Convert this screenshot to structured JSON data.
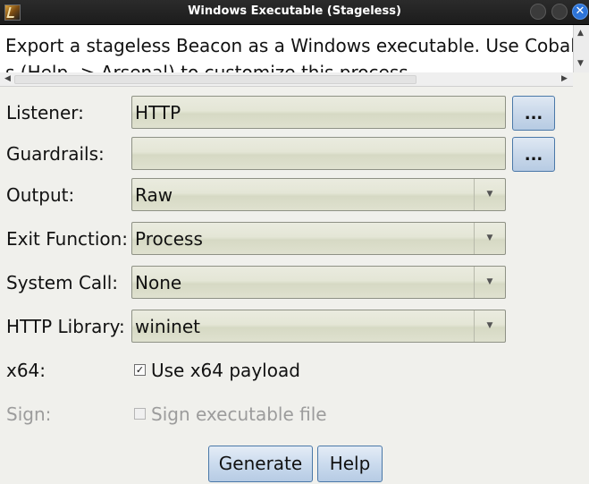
{
  "window": {
    "title": "Windows Executable (Stageless)"
  },
  "description": {
    "line1": "Export a stageless Beacon as a Windows executable. Use Cobal",
    "line2": "s (Help -> Arsenal) to customize this process."
  },
  "form": {
    "listener": {
      "label": "Listener:",
      "value": "HTTP",
      "browse_label": "..."
    },
    "guardrails": {
      "label": "Guardrails:",
      "value": "",
      "browse_label": "..."
    },
    "output": {
      "label": "Output:",
      "value": "Raw"
    },
    "exit_function": {
      "label": "Exit Function:",
      "value": "Process"
    },
    "system_call": {
      "label": "System Call:",
      "value": "None"
    },
    "http_library": {
      "label": "HTTP Library:",
      "value": "wininet"
    },
    "x64": {
      "label": "x64:",
      "checkbox_label": "Use x64 payload",
      "checked": true
    },
    "sign": {
      "label": "Sign:",
      "checkbox_label": "Sign executable file",
      "checked": false,
      "enabled": false
    }
  },
  "buttons": {
    "generate": "Generate",
    "help": "Help"
  },
  "icons": {
    "app": "app-icon",
    "dropdown": "chevron-down-icon",
    "close": "close-icon"
  },
  "colors": {
    "titlebar": "#1c1c1c",
    "close_button": "#2d74d8",
    "field_bg": "#e4e6d6",
    "button_bg": "#cbdbee"
  }
}
